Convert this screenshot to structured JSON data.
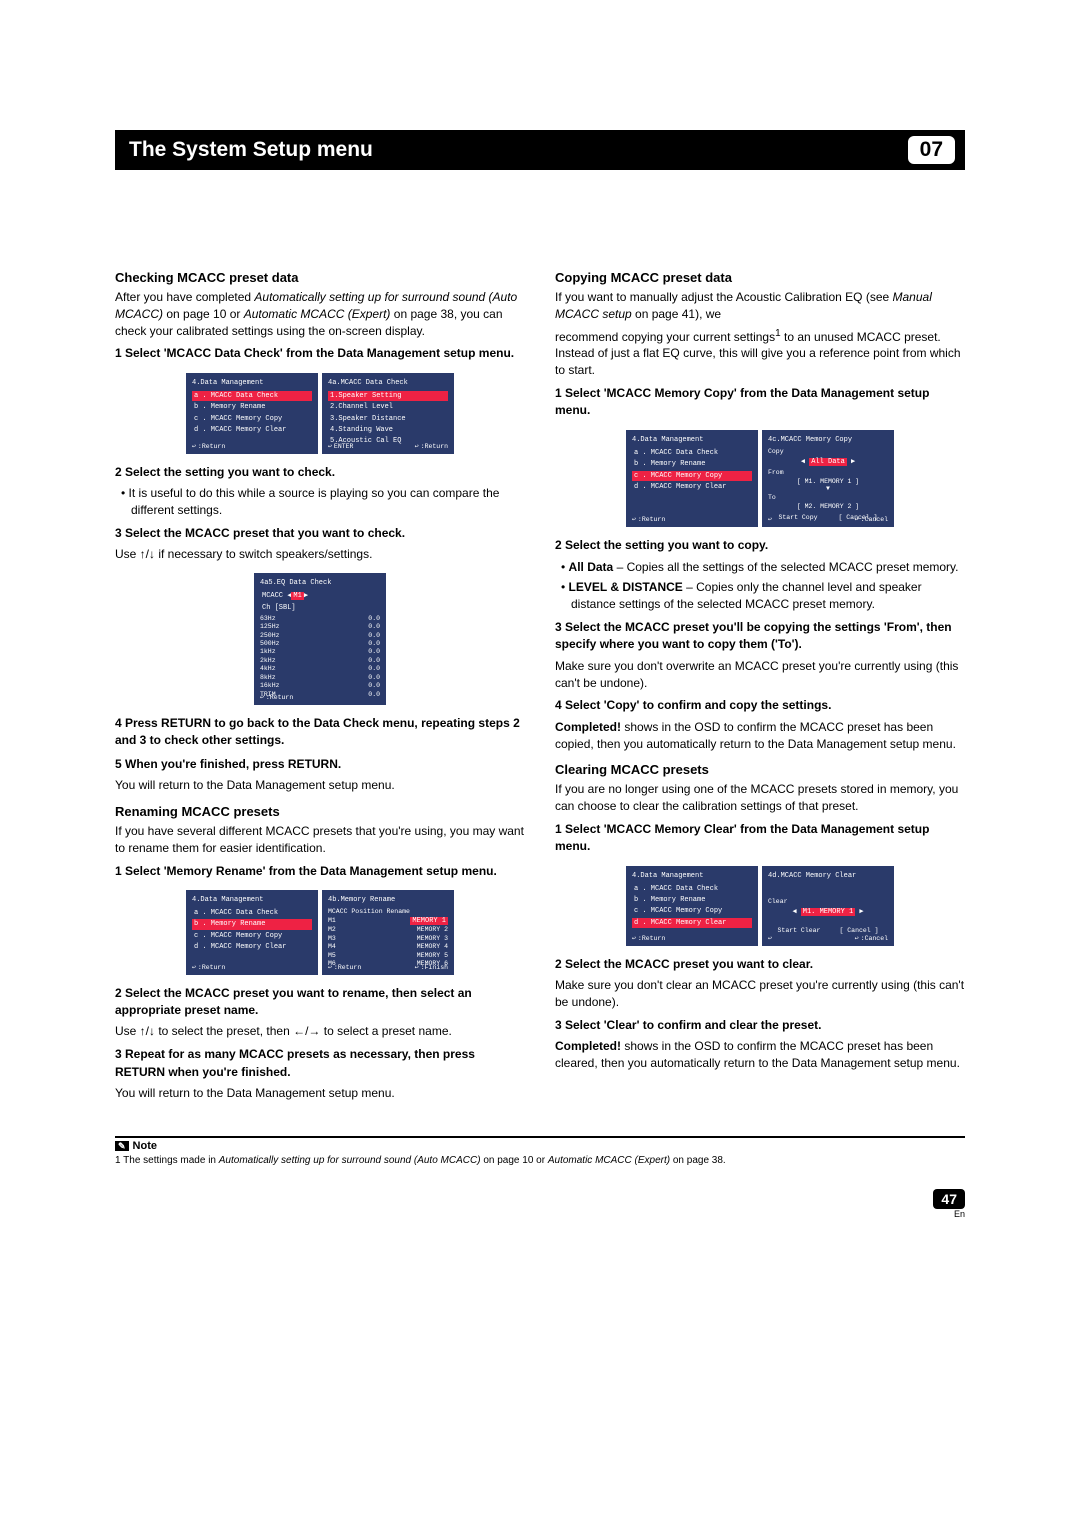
{
  "header": {
    "title": "The System Setup menu",
    "chapter": "07"
  },
  "left": {
    "sec1_title": "Checking MCACC preset data",
    "sec1_p1_a": "After you have completed ",
    "sec1_p1_b": "Automatically setting up for surround sound (Auto MCACC)",
    "sec1_p1_c": " on page 10 or ",
    "sec1_p1_d": "Automatic MCACC (Expert)",
    "sec1_p1_e": " on page 38, you can check your calibrated settings using the on-screen display.",
    "sec1_step1": "1   Select 'MCACC Data Check' from the Data Management setup menu.",
    "sec1_step2": "2   Select the setting you want to check.",
    "sec1_b1": "It is useful to do this while a source is playing so you can compare the different settings.",
    "sec1_step3": "3   Select the MCACC preset that you want to check.",
    "sec1_use": "Use ↑/↓ if necessary to switch speakers/settings.",
    "sec1_step4": "4   Press RETURN to go back to the Data Check menu, repeating steps 2 and 3 to check other settings.",
    "sec1_step5": "5   When you're finished, press RETURN.",
    "sec1_return": "You will return to the Data Management setup menu.",
    "sec2_title": "Renaming MCACC presets",
    "sec2_p1": "If you have several different MCACC presets that you're using, you may want to rename them for easier identification.",
    "sec2_step1": "1   Select 'Memory Rename' from the Data Management setup menu.",
    "sec2_step2": "2   Select the MCACC preset you want to rename, then select an appropriate preset name.",
    "sec2_use": "Use ↑/↓ to select the preset, then ←/→ to select a preset name.",
    "sec2_step3": "3   Repeat for as many MCACC presets as necessary, then press RETURN when you're finished.",
    "sec2_return": "You will return to the Data Management setup menu."
  },
  "right": {
    "sec1_title": "Copying MCACC preset data",
    "sec1_p1_a": "If you want to manually adjust the Acoustic Calibration EQ (see ",
    "sec1_p1_b": "Manual MCACC setup",
    "sec1_p1_c": " on page 41), we",
    "sec1_p2_a": "recommend copying your current settings",
    "sec1_p2_sup": "1",
    "sec1_p2_b": " to an unused MCACC preset. Instead of just a flat EQ curve, this will give you a reference point from which to start.",
    "sec1_step1": "1   Select 'MCACC Memory Copy' from the Data Management setup menu.",
    "sec1_step2": "2   Select the setting you want to copy.",
    "sec1_b1a": "All Data",
    "sec1_b1b": " – Copies all the settings of the selected MCACC preset memory.",
    "sec1_b2a": "LEVEL & DISTANCE",
    "sec1_b2b": " – Copies only the channel level and speaker distance settings of the selected MCACC preset memory.",
    "sec1_step3": "3   Select the MCACC preset you'll be copying the settings 'From', then specify where you want to copy them ('To').",
    "sec1_p3": "Make sure you don't overwrite an MCACC preset you're currently using (this can't be undone).",
    "sec1_step4": "4   Select 'Copy' to confirm and copy the settings.",
    "sec1_p4_a": "Completed!",
    "sec1_p4_b": " shows in the OSD to confirm the MCACC preset has been copied, then you automatically return to the Data Management setup menu.",
    "sec2_title": "Clearing MCACC presets",
    "sec2_p1": "If you are no longer using one of the MCACC presets stored in memory, you can choose to clear the calibration settings of that preset.",
    "sec2_step1": "1   Select 'MCACC Memory Clear' from the Data Management setup menu.",
    "sec2_step2": "2   Select the MCACC preset you want to clear.",
    "sec2_p2": "Make sure you don't clear an MCACC preset you're currently using (this can't be undone).",
    "sec2_step3": "3   Select 'Clear' to confirm and clear the preset.",
    "sec2_p3_a": "Completed!",
    "sec2_p3_b": " shows in the OSD to confirm the MCACC preset has been cleared, then you automatically return to the Data Management setup menu."
  },
  "osd": {
    "dm_title": "4.Data Management",
    "items": {
      "a": "a . MCACC  Data  Check",
      "b": "b . Memory  Rename",
      "c": "c . MCACC  Memory  Copy",
      "d": "d . MCACC  Memory  Clear"
    },
    "return": ":Return",
    "finish": ":Finish",
    "cancel": ":Cancel",
    "enter": "ENTER",
    "datacheck_title": "4a.MCACC  Data  Check",
    "dc": {
      "i1": "1.Speaker Setting",
      "i2": "2.Channel Level",
      "i3": "3.Speaker Distance",
      "i4": "4.Standing Wave",
      "i5": "5.Acoustic Cal EQ"
    },
    "eq_title": "4a5.EQ  Data  Check",
    "eq_head": "MCACC ◀  M1  ▶",
    "eq_ch": "Ch         [SBL]",
    "eq_rows": [
      [
        "63Hz",
        "0.0"
      ],
      [
        "125Hz",
        "0.0"
      ],
      [
        "250Hz",
        "0.0"
      ],
      [
        "500Hz",
        "0.0"
      ],
      [
        "1kHz",
        "0.0"
      ],
      [
        "2kHz",
        "0.0"
      ],
      [
        "4kHz",
        "0.0"
      ],
      [
        "8kHz",
        "0.0"
      ],
      [
        "16kHz",
        "0.0"
      ],
      [
        "TRIM",
        "0.0"
      ]
    ],
    "rename_title": "4b.Memory  Rename",
    "rename_sub": "MCACC Position Rename",
    "rename_rows": [
      [
        "M1",
        "MEMORY  1"
      ],
      [
        "M2",
        "MEMORY  2"
      ],
      [
        "M3",
        "MEMORY  3"
      ],
      [
        "M4",
        "MEMORY  4"
      ],
      [
        "M5",
        "MEMORY  5"
      ],
      [
        "M6",
        "MEMORY  6"
      ]
    ],
    "copy_title": "4c.MCACC  Memory  Copy",
    "copy_copy": "Copy",
    "copy_alldata": "All Data",
    "copy_from": "From",
    "copy_from_v": "[ M1. MEMORY 1 ]",
    "copy_arrow": "▼",
    "copy_to": "To",
    "copy_to_v": "[ M2. MEMORY 2 ]",
    "start_copy": "Start Copy",
    "btn_cancel": "[ Cancel ]",
    "clear_title": "4d.MCACC  Memory  Clear",
    "clear_label": "Clear",
    "clear_val": "M1. MEMORY 1",
    "start_clear": "Start Clear"
  },
  "note": {
    "label": "Note",
    "text_a": "1 The settings made in ",
    "text_b": "Automatically setting up for surround sound (Auto MCACC)",
    "text_c": " on page 10 or ",
    "text_d": "Automatic MCACC (Expert)",
    "text_e": " on page 38."
  },
  "page": {
    "num": "47",
    "lang": "En"
  }
}
